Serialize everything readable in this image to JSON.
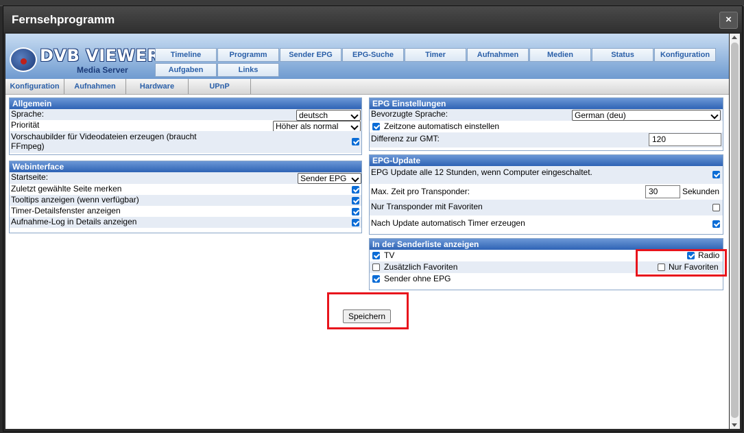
{
  "dialog": {
    "title": "Fernsehprogramm",
    "close_label": "×"
  },
  "logo": {
    "title": "DVB VIEWER",
    "subtitle": "Media Server"
  },
  "nav_tabs": [
    "Timeline",
    "Programm",
    "Sender EPG",
    "EPG-Suche",
    "Timer",
    "Aufnahmen",
    "Medien",
    "Status",
    "Konfiguration",
    "Aufgaben",
    "Links"
  ],
  "sub_tabs": [
    "Konfiguration",
    "Aufnahmen",
    "Hardware",
    "UPnP"
  ],
  "allgemein": {
    "title": "Allgemein",
    "sprache_label": "Sprache:",
    "sprache_value": "deutsch",
    "prioritaet_label": "Priorität",
    "prioritaet_value": "Höher als normal",
    "vorschau_label_1": "Vorschaubilder für Videodateien erzeugen (braucht",
    "vorschau_label_2": "FFmpeg)"
  },
  "webinterface": {
    "title": "Webinterface",
    "startseite_label": "Startseite:",
    "startseite_value": "Sender EPG",
    "zuletzt_label": "Zuletzt gewählte Seite merken",
    "tooltips_label": "Tooltips anzeigen (wenn verfügbar)",
    "timerdetails_label": "Timer-Detailsfenster anzeigen",
    "aufnahmelog_label": "Aufnahme-Log in Details anzeigen"
  },
  "epg_einstellungen": {
    "title": "EPG Einstellungen",
    "sprache_label": "Bevorzugte Sprache:",
    "sprache_value": "German (deu)",
    "zeitzone_label": "Zeitzone automatisch einstellen",
    "gmt_label": "Differenz zur GMT:",
    "gmt_value": "120"
  },
  "epg_update": {
    "title": "EPG-Update",
    "update_label": "EPG Update alle 12 Stunden, wenn Computer eingeschaltet.",
    "maxzeit_label": "Max. Zeit pro Transponder:",
    "maxzeit_value": "30",
    "maxzeit_unit": "Sekunden",
    "nurtransponder_label": "Nur Transponder mit Favoriten",
    "autotimer_label": "Nach Update automatisch Timer erzeugen"
  },
  "senderliste": {
    "title": "In der Senderliste anzeigen",
    "tv_label": "TV",
    "radio_label": "Radio",
    "zusatz_label": "Zusätzlich Favoriten",
    "nurfav_label": "Nur Favoriten",
    "ohneepg_label": "Sender ohne EPG"
  },
  "save_label": "Speichern",
  "colors": {
    "highlight": "#e8141c",
    "panel_header": "#2e63b5",
    "checkbox": "#0a6cd6"
  }
}
